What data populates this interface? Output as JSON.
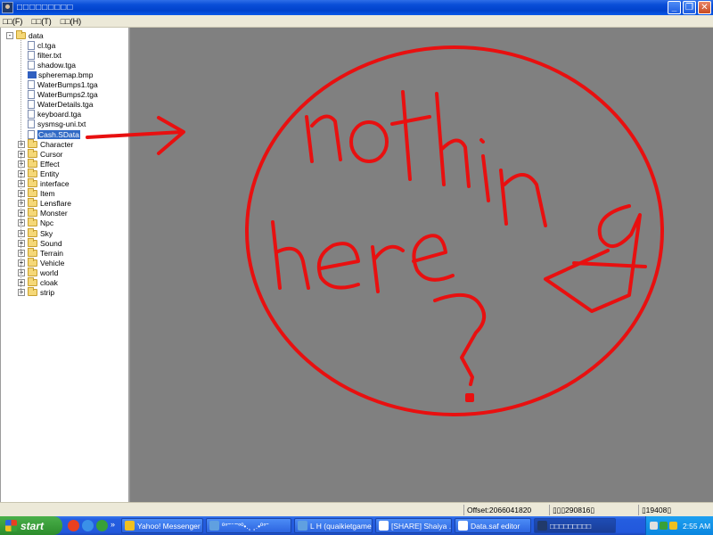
{
  "window": {
    "title": "□□□□□□□□□",
    "minimize": "_",
    "restore": "❐",
    "close": "✕"
  },
  "menu": [
    "□□(F)",
    "□□(T)",
    "□□(H)"
  ],
  "tree": {
    "root": "data",
    "files": [
      {
        "name": "cl.tga",
        "icon": "file-icon"
      },
      {
        "name": "filter.txt",
        "icon": "file-icon"
      },
      {
        "name": "shadow.tga",
        "icon": "file-icon"
      },
      {
        "name": "spheremap.bmp",
        "icon": "bmp-icon"
      },
      {
        "name": "WaterBumps1.tga",
        "icon": "file-icon"
      },
      {
        "name": "WaterBumps2.tga",
        "icon": "file-icon"
      },
      {
        "name": "WaterDetails.tga",
        "icon": "file-icon"
      },
      {
        "name": "keyboard.tga",
        "icon": "file-icon"
      },
      {
        "name": "sysmsg-uni.txt",
        "icon": "file-icon"
      },
      {
        "name": "Cash.SData",
        "icon": "file-icon",
        "selected": true
      }
    ],
    "folders": [
      "Character",
      "Cursor",
      "Effect",
      "Entity",
      "interface",
      "Item",
      "Lensflare",
      "Monster",
      "Npc",
      "Sky",
      "Sound",
      "Terrain",
      "Vehicle",
      "world",
      "cloak",
      "strip"
    ]
  },
  "drawing": {
    "stroke_color": "#e81010",
    "canvas_color": "#808080",
    "text_line1": "nothing",
    "text_line2": "here",
    "mark": "?"
  },
  "status": {
    "offset": "Offset:2066041820",
    "seg2": "▯▯▯290816▯",
    "seg3": "▯19408▯"
  },
  "taskbar": {
    "start": "start",
    "tasks": [
      {
        "label": "Yahoo! Messenger",
        "color": "#f0c020"
      },
      {
        "label": "º°˜¨¨˜°º•.¸ ¸.•º°˜",
        "color": "#60a0e0"
      },
      {
        "label": "L H (quaikietgamer)",
        "color": "#60a0e0"
      },
      {
        "label": "[SHARE] Shaiya ...",
        "color": "#ffffff"
      },
      {
        "label": "Data.saf editor",
        "color": "#ffffff"
      },
      {
        "label": "□□□□□□□□□",
        "color": "#213a6a",
        "active": true
      }
    ],
    "more": "»",
    "clock": "2:55 AM"
  }
}
